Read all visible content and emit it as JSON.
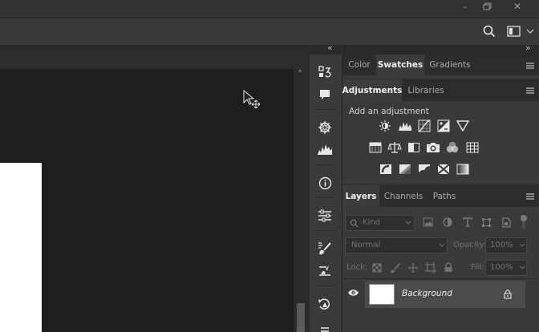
{
  "window": {
    "minimize_glyph": "–",
    "restore_glyph": "❐",
    "close_glyph": "✕"
  },
  "options_bar": {
    "icons": [
      "search-icon",
      "workspace-icon",
      "chevron-down-icon"
    ]
  },
  "dock": {
    "collapse_glyph": "«",
    "scroll_up_glyph": "˄",
    "icons": [
      "history-icon",
      "comments-icon",
      "navigator-icon",
      "histogram-icon",
      "info-icon",
      "properties-icon",
      "brush-settings-icon",
      "tool-presets-icon",
      "actions-icon"
    ]
  },
  "panels": {
    "collapse_glyph": "»",
    "color_group": {
      "tabs": [
        "Color",
        "Swatches",
        "Gradients"
      ],
      "active": "Swatches"
    },
    "adjustments": {
      "tabs": [
        "Adjustments",
        "Libraries"
      ],
      "active": "Adjustments",
      "prompt": "Add an adjustment",
      "row1": [
        "brightness-contrast-icon",
        "levels-icon",
        "curves-icon",
        "exposure-icon",
        "vibrance-icon"
      ],
      "row2": [
        "hue-saturation-icon",
        "color-balance-icon",
        "black-white-icon",
        "photo-filter-icon",
        "channel-mixer-icon",
        "color-lookup-icon"
      ],
      "row3": [
        "invert-icon",
        "posterize-icon",
        "threshold-icon",
        "selective-color-icon",
        "gradient-map-icon"
      ]
    },
    "layers": {
      "tabs": [
        "Layers",
        "Channels",
        "Paths"
      ],
      "active": "Layers",
      "filter_label": "Kind",
      "blend_mode": "Normal",
      "opacity_label": "Opacity:",
      "opacity_value": "100%",
      "lock_label": "Lock:",
      "fill_label": "Fill:",
      "fill_value": "100%",
      "layer_name": "Background"
    }
  },
  "colors": {
    "bg": "#323232",
    "canvas": "#1e1e1e",
    "panel": "#3a3a3a",
    "active_tab": "#3c3c3c",
    "selected_row": "#4b4b4b"
  }
}
